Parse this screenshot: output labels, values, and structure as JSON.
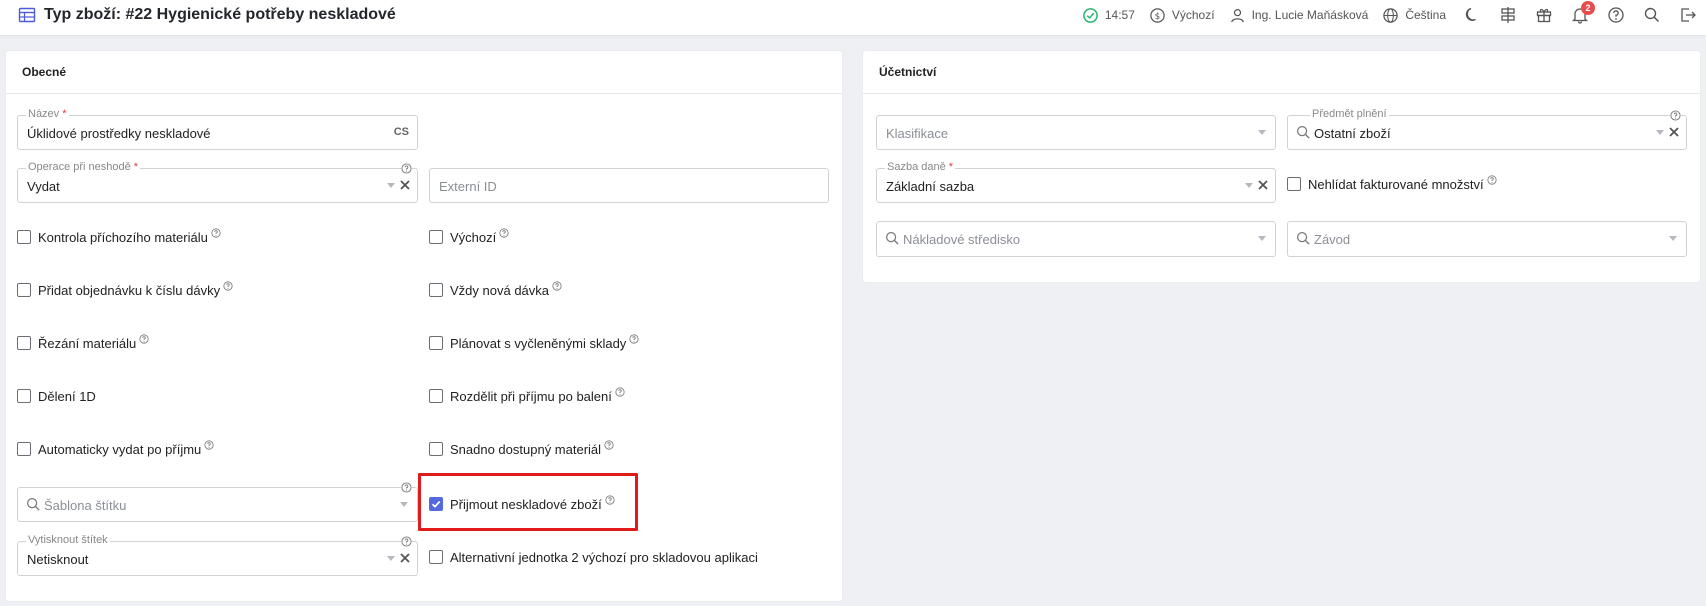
{
  "header": {
    "title": "Typ zboží: #22 Hygienické potřeby neskladové",
    "time": "14:57",
    "currency": "Výchozí",
    "user": "Ing. Lucie Maňásková",
    "language": "Čeština",
    "notification_count": "2"
  },
  "general": {
    "title": "Obecné",
    "name_label": "Název",
    "name_value": "Úklidové prostředky neskladové",
    "name_lang": "CS",
    "op_label": "Operace při neshodě",
    "op_value": "Vydat",
    "external_id_placeholder": "Externí ID",
    "label_template_placeholder": "Šablona štítku",
    "print_label_label": "Vytisknout štítek",
    "print_label_value": "Netisknout",
    "checks_left": [
      {
        "label": "Kontrola příchozího materiálu",
        "checked": false
      },
      {
        "label": "Přidat objednávku k číslu dávky",
        "checked": false
      },
      {
        "label": "Řezání materiálu",
        "checked": false
      },
      {
        "label": "Dělení 1D",
        "checked": false
      },
      {
        "label": "Automaticky vydat po příjmu",
        "checked": false
      }
    ],
    "checks_right": [
      {
        "label": "Výchozí",
        "checked": false
      },
      {
        "label": "Vždy nová dávka",
        "checked": false
      },
      {
        "label": "Plánovat s vyčleněnými sklady",
        "checked": false
      },
      {
        "label": "Rozdělit při příjmu po balení",
        "checked": false
      },
      {
        "label": "Snadno dostupný materiál",
        "checked": false
      },
      {
        "label": "Přijmout neskladové zboží",
        "checked": true
      },
      {
        "label": "Alternativní jednotka 2 výchozí pro skladovou aplikaci",
        "checked": false
      }
    ]
  },
  "accounting": {
    "title": "Účetnictví",
    "classification_placeholder": "Klasifikace",
    "subject_label": "Předmět plnění",
    "subject_value": "Ostatní zboží",
    "tax_label": "Sazba daně",
    "tax_value": "Základní sazba",
    "no_check_invoiced": "Nehlídat fakturované množství",
    "cost_center_placeholder": "Nákladové středisko",
    "plant_placeholder": "Závod"
  },
  "colors": {
    "accent": "#5468e0",
    "required": "#e23b3b",
    "highlight": "#e01b1b",
    "status_ok": "#2bb673"
  }
}
